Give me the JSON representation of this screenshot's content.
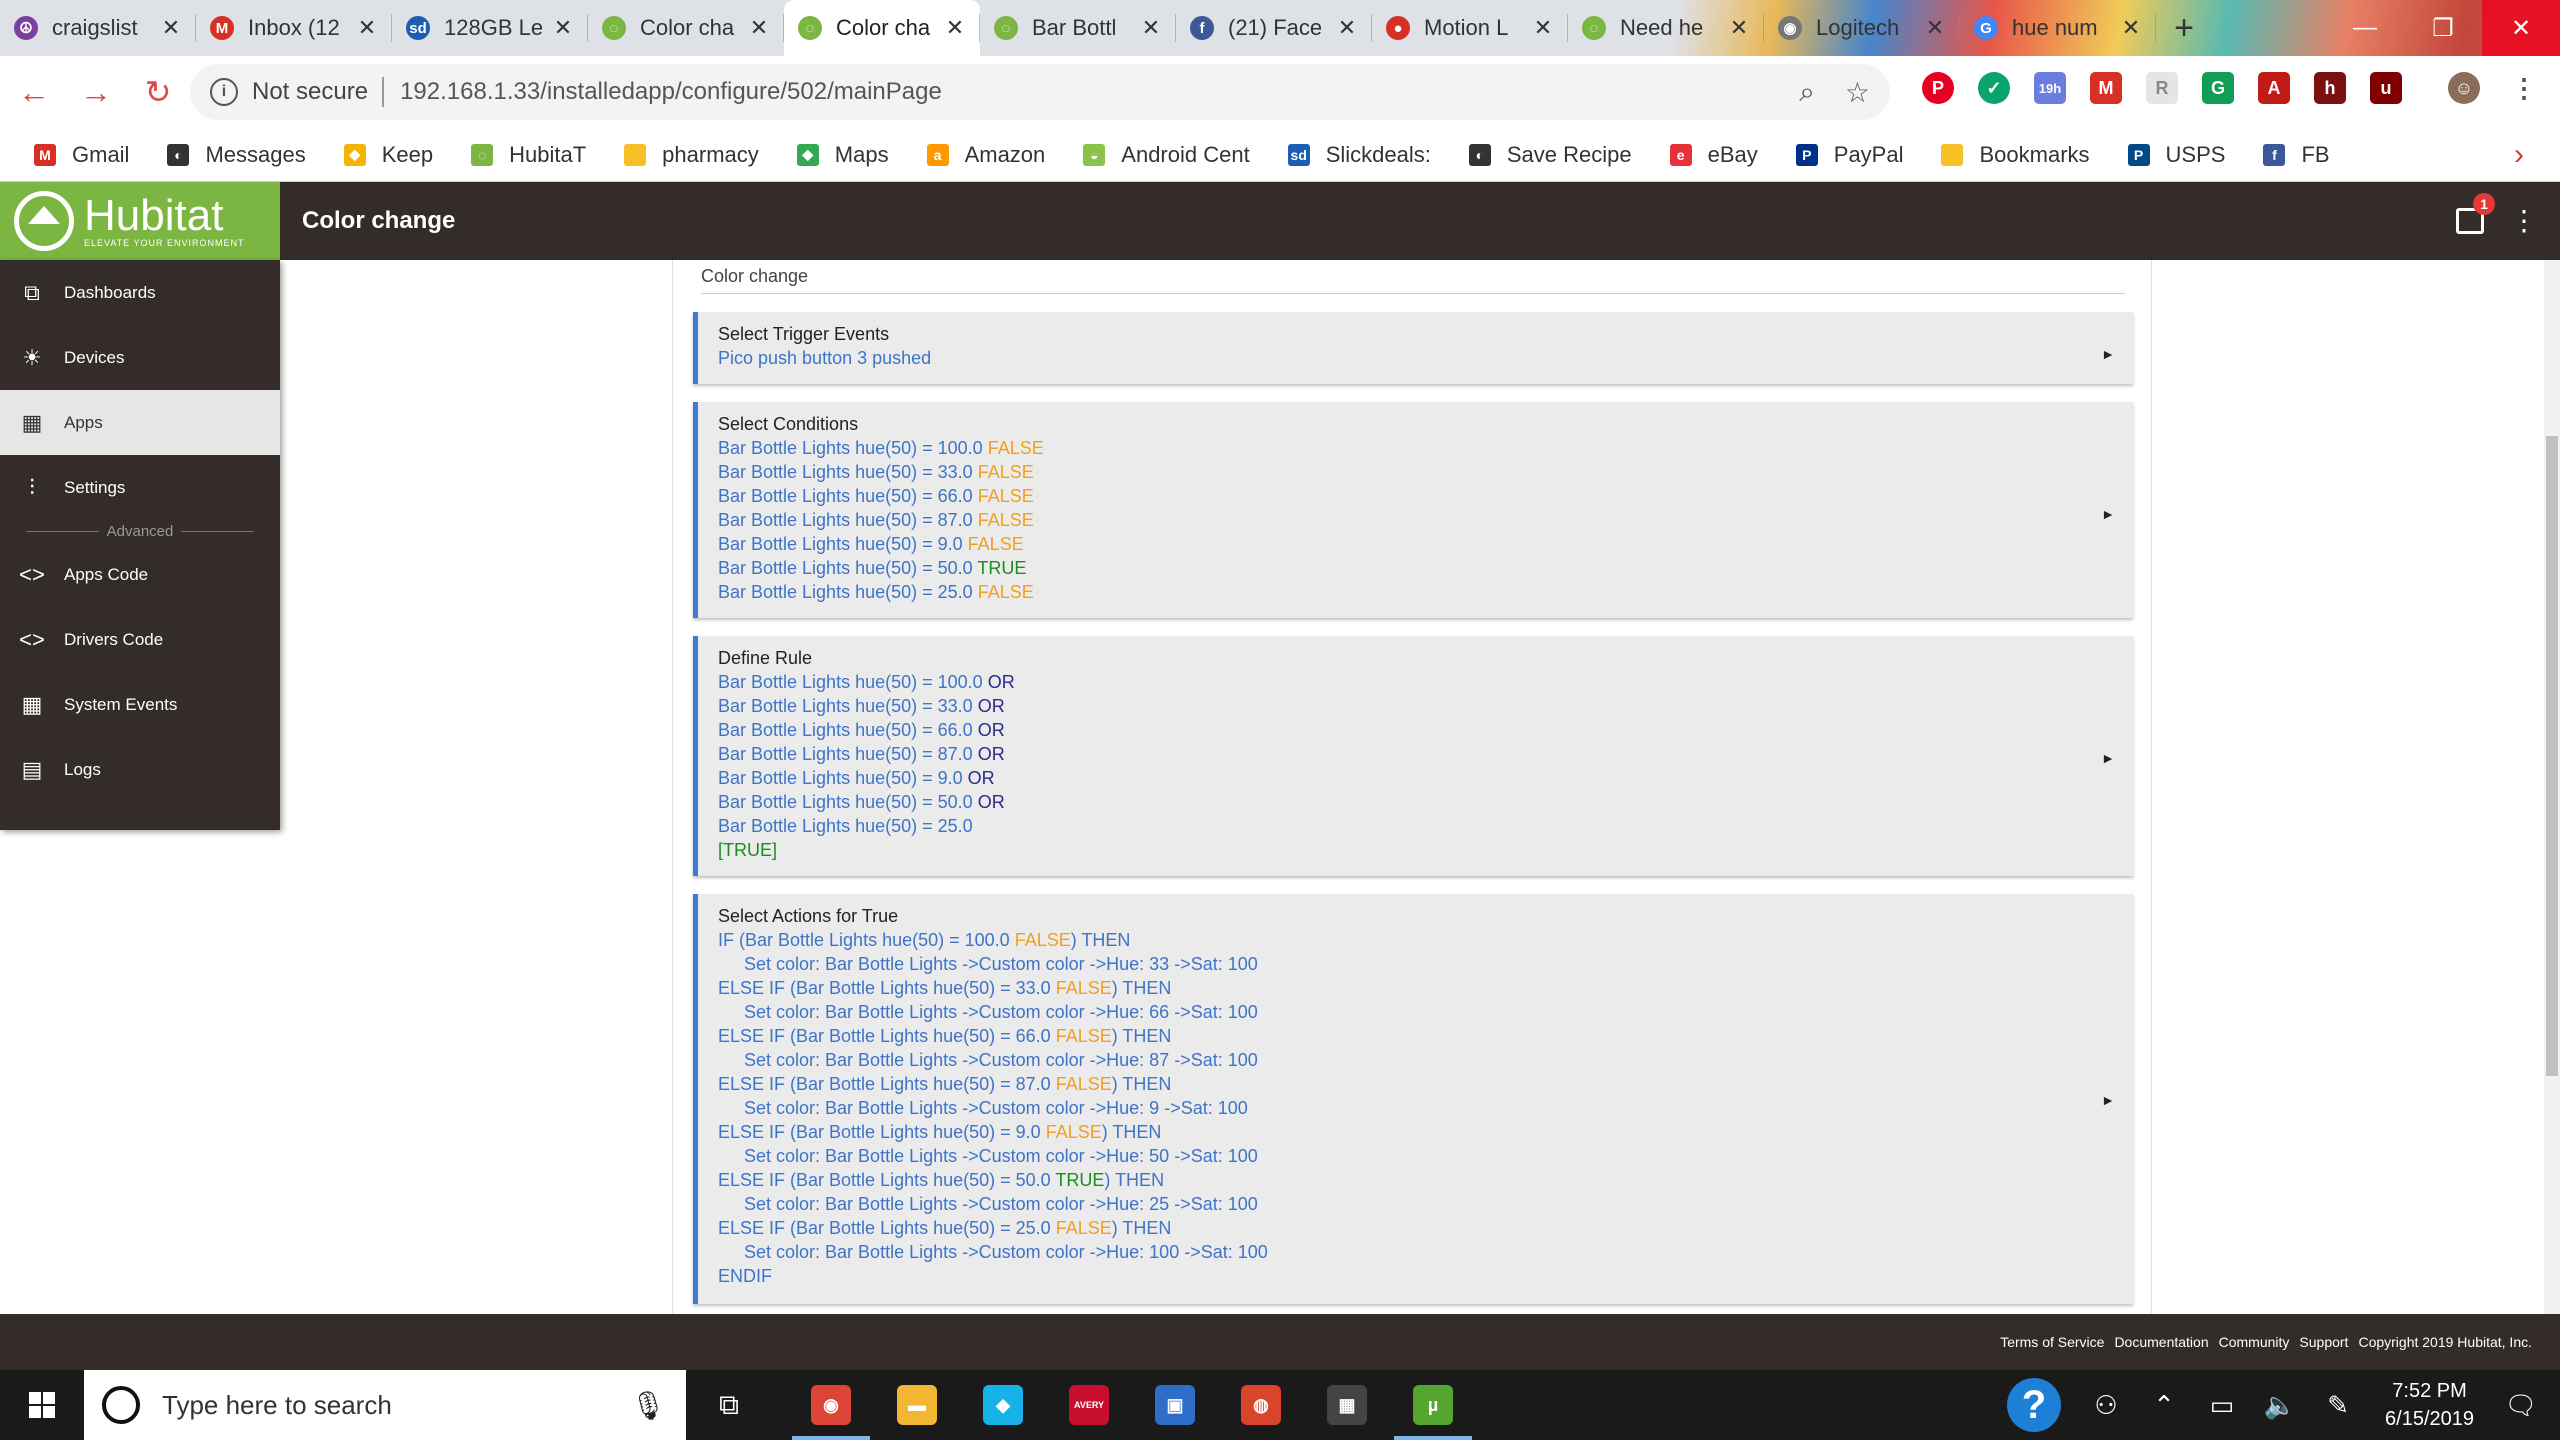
{
  "browser": {
    "tabs": [
      {
        "title": "craigslist",
        "fav_color": "#7b3fa0",
        "fav_glyph": "☮"
      },
      {
        "title": "Inbox (12",
        "fav_color": "#d93025",
        "fav_glyph": "M"
      },
      {
        "title": "128GB Le",
        "fav_color": "#1a5fb4",
        "fav_glyph": "sd"
      },
      {
        "title": "Color cha",
        "fav_color": "#7bb542",
        "fav_glyph": "◌"
      },
      {
        "title": "Color cha",
        "fav_color": "#7bb542",
        "fav_glyph": "◌",
        "active": true
      },
      {
        "title": "Bar Bottl",
        "fav_color": "#7bb542",
        "fav_glyph": "◌"
      },
      {
        "title": "(21) Face",
        "fav_color": "#3b5998",
        "fav_glyph": "f"
      },
      {
        "title": "Motion L",
        "fav_color": "#d93025",
        "fav_glyph": "●"
      },
      {
        "title": "Need he",
        "fav_color": "#7bb542",
        "fav_glyph": "◌"
      },
      {
        "title": "Logitech",
        "fav_color": "#777777",
        "fav_glyph": "◉"
      },
      {
        "title": "hue num",
        "fav_color": "#4285f4",
        "fav_glyph": "G"
      }
    ],
    "new_tab_icon": "+",
    "omnibox": {
      "security_label": "Not secure",
      "url": "192.168.1.33/installedapp/configure/502/mainPage"
    },
    "extension_badge": "19h",
    "bookmarks": [
      {
        "label": "Gmail",
        "color": "#d93025",
        "glyph": "M"
      },
      {
        "label": "Messages",
        "color": "#333333",
        "glyph": "◐"
      },
      {
        "label": "Keep",
        "color": "#f4b400",
        "glyph": "◆"
      },
      {
        "label": "HubitaT",
        "color": "#7bb542",
        "glyph": "◌"
      },
      {
        "label": "pharmacy",
        "color": "#f6c026",
        "glyph": ""
      },
      {
        "label": "Maps",
        "color": "#34a853",
        "glyph": "◆"
      },
      {
        "label": "Amazon",
        "color": "#ff9900",
        "glyph": "a"
      },
      {
        "label": "Android Cent",
        "color": "#8bc34a",
        "glyph": "◒"
      },
      {
        "label": "Slickdeals:",
        "color": "#1a5fb4",
        "glyph": "sd"
      },
      {
        "label": "Save Recipe",
        "color": "#333333",
        "glyph": "◐"
      },
      {
        "label": "eBay",
        "color": "#e53238",
        "glyph": "e"
      },
      {
        "label": "PayPal",
        "color": "#003087",
        "glyph": "P"
      },
      {
        "label": "Bookmarks",
        "color": "#f6c026",
        "glyph": ""
      },
      {
        "label": "USPS",
        "color": "#004b87",
        "glyph": "P"
      },
      {
        "label": "FB",
        "color": "#3b5998",
        "glyph": "f"
      }
    ]
  },
  "app": {
    "brand_name": "Hubitat",
    "brand_tagline": "ELEVATE YOUR ENVIRONMENT",
    "page_title": "Color change",
    "notification_count": "1",
    "sidebar": {
      "items": [
        {
          "label": "Dashboards",
          "icon": "dashboards-icon",
          "glyph": "⧉"
        },
        {
          "label": "Devices",
          "icon": "lightbulb-icon",
          "glyph": "☀"
        },
        {
          "label": "Apps",
          "icon": "apps-icon",
          "glyph": "▦",
          "active": true
        },
        {
          "label": "Settings",
          "icon": "settings-icon",
          "glyph": "⫶"
        }
      ],
      "advanced_label": "Advanced",
      "advanced_items": [
        {
          "label": "Apps Code",
          "icon": "code-icon",
          "glyph": "<>"
        },
        {
          "label": "Drivers Code",
          "icon": "code-icon",
          "glyph": "<>"
        },
        {
          "label": "System Events",
          "icon": "calendar-icon",
          "glyph": "▦"
        },
        {
          "label": "Logs",
          "icon": "document-icon",
          "glyph": "▤"
        }
      ]
    },
    "rule_name": "Color change",
    "sections": {
      "trigger": {
        "title": "Select Trigger Events",
        "lines": [
          "Pico push button 3 pushed"
        ]
      },
      "conditions": {
        "title": "Select Conditions",
        "lines": [
          {
            "text": "Bar Bottle Lights hue(50) = 100.0",
            "state": "FALSE"
          },
          {
            "text": "Bar Bottle Lights hue(50) = 33.0",
            "state": "FALSE"
          },
          {
            "text": "Bar Bottle Lights hue(50) = 66.0",
            "state": "FALSE"
          },
          {
            "text": "Bar Bottle Lights hue(50) = 87.0",
            "state": "FALSE"
          },
          {
            "text": "Bar Bottle Lights hue(50) = 9.0",
            "state": "FALSE"
          },
          {
            "text": "Bar Bottle Lights hue(50) = 50.0",
            "state": "TRUE"
          },
          {
            "text": "Bar Bottle Lights hue(50) = 25.0",
            "state": "FALSE"
          }
        ]
      },
      "rule": {
        "title": "Define Rule",
        "lines": [
          {
            "text": "Bar Bottle Lights hue(50) = 100.0",
            "op": "OR"
          },
          {
            "text": "Bar Bottle Lights hue(50) = 33.0",
            "op": "OR"
          },
          {
            "text": "Bar Bottle Lights hue(50) = 66.0",
            "op": "OR"
          },
          {
            "text": "Bar Bottle Lights hue(50) = 87.0",
            "op": "OR"
          },
          {
            "text": "Bar Bottle Lights hue(50) = 9.0",
            "op": "OR"
          },
          {
            "text": "Bar Bottle Lights hue(50) = 50.0",
            "op": "OR"
          },
          {
            "text": "Bar Bottle Lights hue(50) = 25.0",
            "op": ""
          }
        ],
        "result": "[TRUE]"
      },
      "actions": {
        "title": "Select Actions for True",
        "blocks": [
          {
            "keyword": "IF",
            "cond": "Bar Bottle Lights hue(50) = 100.0",
            "state": "FALSE",
            "action": "Set color: Bar Bottle Lights ->Custom color ->Hue: 33 ->Sat: 100"
          },
          {
            "keyword": "ELSE IF",
            "cond": "Bar Bottle Lights hue(50) = 33.0",
            "state": "FALSE",
            "action": "Set color: Bar Bottle Lights ->Custom color ->Hue: 66 ->Sat: 100"
          },
          {
            "keyword": "ELSE IF",
            "cond": "Bar Bottle Lights hue(50) = 66.0",
            "state": "FALSE",
            "action": "Set color: Bar Bottle Lights ->Custom color ->Hue: 87 ->Sat: 100"
          },
          {
            "keyword": "ELSE IF",
            "cond": "Bar Bottle Lights hue(50) = 87.0",
            "state": "FALSE",
            "action": "Set color: Bar Bottle Lights ->Custom color ->Hue: 9 ->Sat: 100"
          },
          {
            "keyword": "ELSE IF",
            "cond": "Bar Bottle Lights hue(50) = 9.0",
            "state": "FALSE",
            "action": "Set color: Bar Bottle Lights ->Custom color ->Hue: 50 ->Sat: 100"
          },
          {
            "keyword": "ELSE IF",
            "cond": "Bar Bottle Lights hue(50) = 50.0",
            "state": "TRUE",
            "action": "Set color: Bar Bottle Lights ->Custom color ->Hue: 25 ->Sat: 100"
          },
          {
            "keyword": "ELSE IF",
            "cond": "Bar Bottle Lights hue(50) = 25.0",
            "state": "FALSE",
            "action": "Set color: Bar Bottle Lights ->Custom color ->Hue: 100 ->Sat: 100"
          }
        ],
        "then_word": "THEN",
        "end": "ENDIF"
      }
    },
    "footer_links": [
      "Terms of Service",
      "Documentation",
      "Community",
      "Support",
      "Copyright 2019 Hubitat, Inc."
    ]
  },
  "taskbar": {
    "search_placeholder": "Type here to search",
    "apps": [
      {
        "name": "chrome",
        "color": "#db4437",
        "glyph": "◉",
        "open": true
      },
      {
        "name": "file-explorer",
        "color": "#f2b632",
        "glyph": "▬"
      },
      {
        "name": "kodi",
        "color": "#17b2e7",
        "glyph": "◆"
      },
      {
        "name": "avery",
        "color": "#c8102e",
        "glyph": "AVERY"
      },
      {
        "name": "network",
        "color": "#2e6ec8",
        "glyph": "▣"
      },
      {
        "name": "game",
        "color": "#d9442a",
        "glyph": "◍"
      },
      {
        "name": "calculator",
        "color": "#444444",
        "glyph": "▦"
      },
      {
        "name": "utorrent",
        "color": "#55a630",
        "glyph": "µ",
        "open": true
      }
    ],
    "time": "7:52 PM",
    "date": "6/15/2019"
  },
  "colors": {
    "brand_green": "#7bb542",
    "header_dark": "#332c29",
    "accent_blue": "#3f7ad8",
    "false_orange": "#f0a020",
    "true_green": "#1c8c1c"
  }
}
